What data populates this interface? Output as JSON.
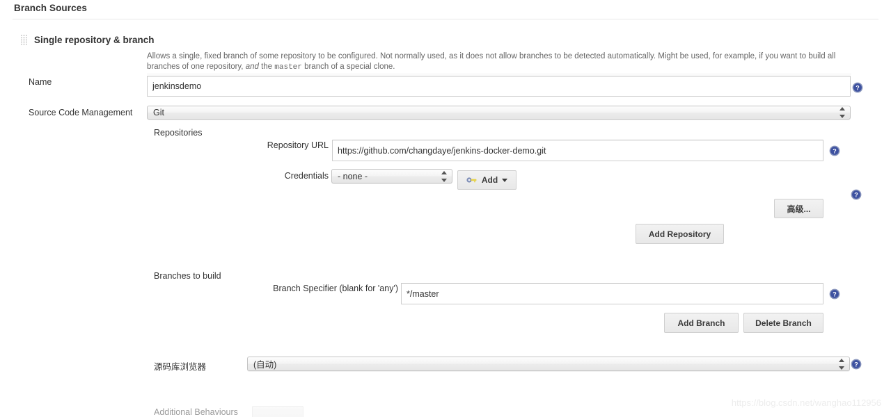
{
  "section": {
    "title": "Branch Sources"
  },
  "block": {
    "title": "Single repository & branch",
    "grip_icon": "drag-grip-icon",
    "description_part1": "Allows a single, fixed branch of some repository to be configured. Not normally used, as it does not allow branches to be detected automatically. Might be used, for example, if you want to build all branches of one repository, ",
    "description_italic": "and",
    "description_part2": " the ",
    "description_mono": "master",
    "description_part3": " branch of a special clone."
  },
  "fields": {
    "name_label": "Name",
    "name_value": "jenkinsdemo",
    "name_placeholder": "",
    "scm_label": "Source Code Management",
    "scm_value": "Git",
    "repositories_label": "Repositories",
    "repo_url_label": "Repository URL",
    "repo_url_value": "https://github.com/changdaye/jenkins-docker-demo.git",
    "repo_url_placeholder": "",
    "credentials_label": "Credentials",
    "credentials_value": "- none -",
    "branches_label": "Branches to build",
    "branch_specifier_label": "Branch Specifier (blank for 'any')",
    "branch_specifier_value": "*/master",
    "branch_specifier_placeholder": "",
    "repo_browser_label": "源码库浏览器",
    "repo_browser_value": "(自动)",
    "additional_behaviours_label": "Additional Behaviours"
  },
  "buttons": {
    "add_credentials": "Add",
    "add_credentials_icon": "key-icon",
    "add_credentials_caret": "caret-down-icon",
    "advanced": "高级...",
    "add_repository": "Add Repository",
    "add_branch": "Add Branch",
    "delete_branch": "Delete Branch"
  },
  "help_icons": {
    "name_help": "help-icon",
    "repo_url_help": "help-icon",
    "credentials_help": "help-icon",
    "branch_specifier_help": "help-icon",
    "repo_browser_help": "help-icon"
  },
  "watermark": {
    "text": "https://blog.csdn.net/wanghao112956"
  },
  "colors": {
    "help_blue": "#4a5f9e",
    "text": "#333333",
    "muted": "#666666",
    "border": "#cccccc",
    "watermark": "#ededed"
  }
}
